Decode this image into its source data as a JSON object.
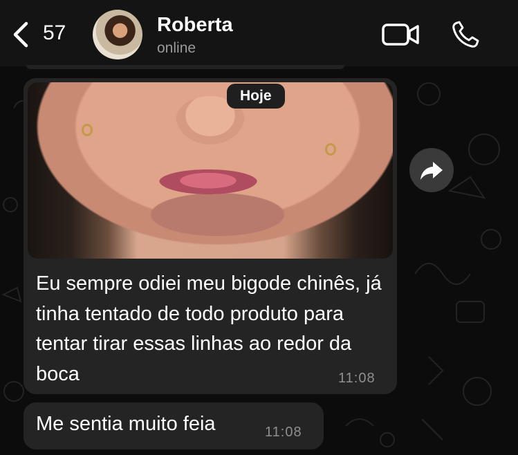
{
  "header": {
    "unread_count": "57",
    "contact_name": "Roberta",
    "status": "online"
  },
  "chat": {
    "date_divider": "Hoje",
    "messages": [
      {
        "type": "image-with-caption",
        "text": "Eu sempre odiei meu bigode chinês, já tinha tentado de todo produto para tentar tirar essas linhas ao redor da boca",
        "time": "11:08"
      },
      {
        "type": "text",
        "text": "Me sentia muito feia",
        "time": "11:08"
      }
    ]
  },
  "icons": {
    "back": "chevron-left-icon",
    "video": "video-camera-icon",
    "call": "phone-icon",
    "forward": "share-arrow-icon"
  }
}
